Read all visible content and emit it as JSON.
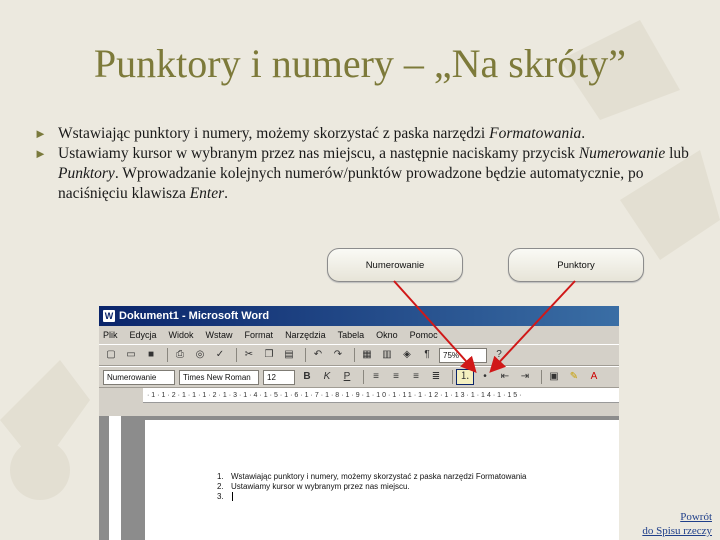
{
  "slide": {
    "title": "Punktory i numery – „Na skróty”",
    "bullets": [
      {
        "text_before": "Wstawiając punktory i numery, możemy skorzystać z paska narzędzi ",
        "italic": "Formatowania",
        "text_after": "."
      },
      {
        "text_before": "Ustawiamy kursor w wybranym przez nas miejscu, a następnie naciskamy przycisk ",
        "italic": "Numerowanie",
        "text_mid": " lub ",
        "italic2": "Punktory",
        "text_after": ". Wprowadzanie kolejnych numerów/punktów prowadzone będzie automatycznie, po naciśnięciu klawisza ",
        "italic3": "Enter",
        "text_end": "."
      }
    ],
    "callouts": {
      "numbering": "Numerowanie",
      "bullets": "Punktory"
    },
    "back_link": {
      "line1": "Powrót",
      "line2": "do Spisu rzeczy"
    }
  },
  "word_window": {
    "title": "Dokument1 - Microsoft Word",
    "menu": [
      "Plik",
      "Edycja",
      "Widok",
      "Wstaw",
      "Format",
      "Narzędzia",
      "Tabela",
      "Okno",
      "Pomoc"
    ],
    "style_box": "Numerowanie",
    "font_box": "Times New Roman",
    "size_box": "12",
    "zoom_box": "75%",
    "doc_lines": [
      {
        "num": "1.",
        "text": "Wstawiając punktory i numery, możemy skorzystać z paska narzędzi Formatowania"
      },
      {
        "num": "2.",
        "text": "Ustawiamy kursor w wybranym przez nas miejscu."
      },
      {
        "num": "3.",
        "text": ""
      }
    ]
  },
  "colors": {
    "title": "#7d7a3a",
    "arrow": "#d01818",
    "word_title_bar": "#0a246a"
  }
}
